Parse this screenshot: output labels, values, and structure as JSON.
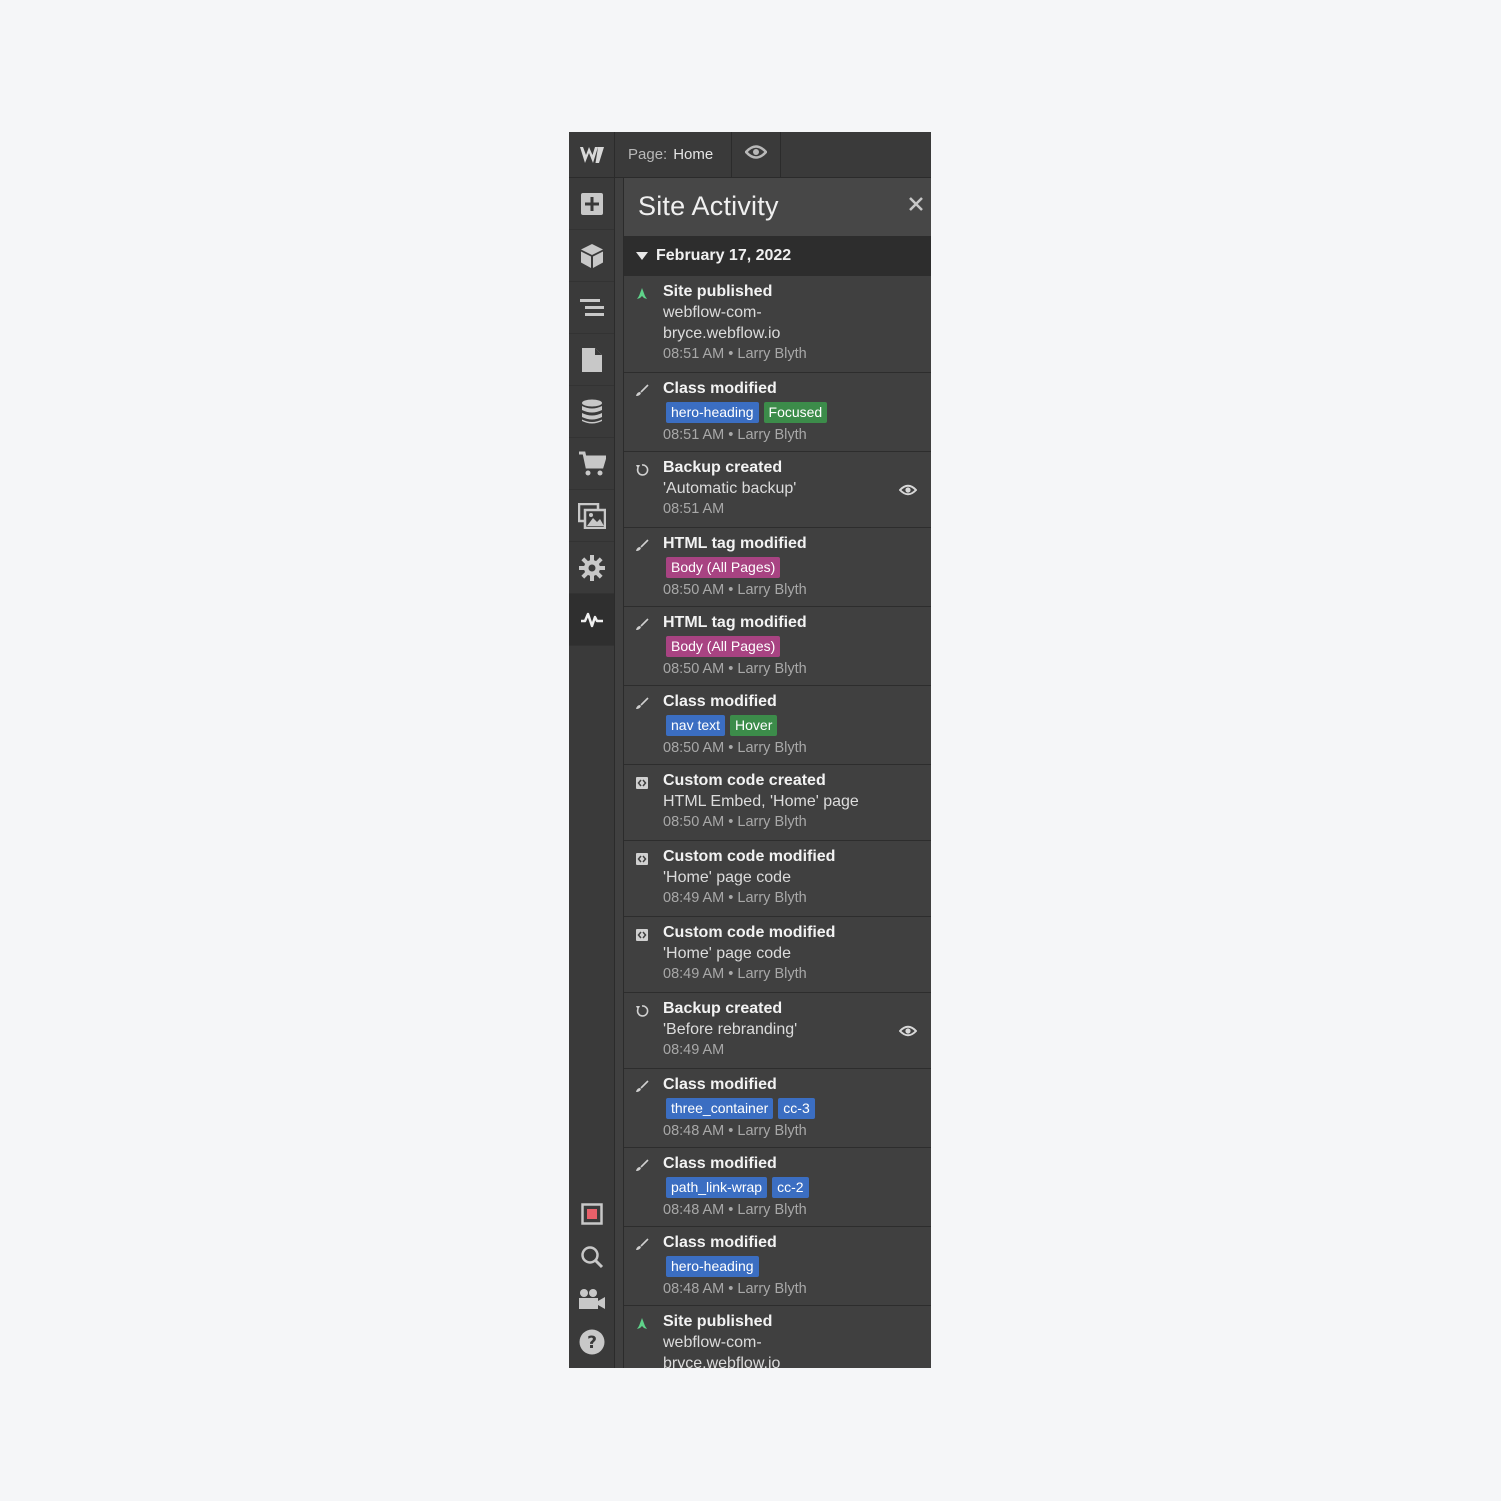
{
  "topbar": {
    "page_prefix": "Page:",
    "page_name": "Home"
  },
  "rail": {
    "items": [
      {
        "icon": "webflow-logo-icon"
      },
      {
        "icon": "add-icon"
      },
      {
        "icon": "components-cube-icon"
      },
      {
        "icon": "navigator-icon"
      },
      {
        "icon": "pages-icon"
      },
      {
        "icon": "cms-database-icon"
      },
      {
        "icon": "ecommerce-cart-icon"
      },
      {
        "icon": "assets-icon"
      },
      {
        "icon": "settings-gear-icon"
      },
      {
        "icon": "site-activity-icon"
      }
    ],
    "bottom_items": [
      {
        "icon": "audit-icon"
      },
      {
        "icon": "search-icon"
      },
      {
        "icon": "video-tutorials-icon"
      },
      {
        "icon": "help-icon"
      }
    ]
  },
  "panel": {
    "title": "Site Activity",
    "date_group": "February 17, 2022"
  },
  "colors": {
    "published_green": "#5fd38a",
    "tag_blue": "#3b6ec2",
    "tag_green": "#3c8c4a",
    "tag_pink": "#a84382"
  },
  "events": [
    {
      "icon": "rocket-icon",
      "title": "Site published",
      "detail_lines": [
        "webflow-com-",
        "bryce.webflow.io"
      ],
      "tags": [],
      "meta": "08:51 AM • Larry Blyth",
      "preview": false
    },
    {
      "icon": "brush-icon",
      "title": "Class modified",
      "detail_lines": [],
      "tags": [
        {
          "label": "hero-heading",
          "color": "blue"
        },
        {
          "label": "Focused",
          "color": "green"
        }
      ],
      "meta": "08:51 AM • Larry Blyth",
      "preview": false
    },
    {
      "icon": "backup-icon",
      "title": "Backup created",
      "detail_lines": [
        "'Automatic backup'"
      ],
      "tags": [],
      "meta": "08:51 AM",
      "preview": true
    },
    {
      "icon": "brush-icon",
      "title": "HTML tag modified",
      "detail_lines": [],
      "tags": [
        {
          "label": "Body (All Pages)",
          "color": "pink"
        }
      ],
      "meta": "08:50 AM • Larry Blyth",
      "preview": false
    },
    {
      "icon": "brush-icon",
      "title": "HTML tag modified",
      "detail_lines": [],
      "tags": [
        {
          "label": "Body (All Pages)",
          "color": "pink"
        }
      ],
      "meta": "08:50 AM • Larry Blyth",
      "preview": false
    },
    {
      "icon": "brush-icon",
      "title": "Class modified",
      "detail_lines": [],
      "tags": [
        {
          "label": "nav text",
          "color": "blue"
        },
        {
          "label": "Hover",
          "color": "green"
        }
      ],
      "meta": "08:50 AM • Larry Blyth",
      "preview": false
    },
    {
      "icon": "code-icon",
      "title": "Custom code created",
      "detail_lines": [
        "HTML Embed, 'Home' page"
      ],
      "tags": [],
      "meta": "08:50 AM • Larry Blyth",
      "preview": false
    },
    {
      "icon": "code-icon",
      "title": "Custom code modified",
      "detail_lines": [
        "'Home' page code"
      ],
      "tags": [],
      "meta": "08:49 AM • Larry Blyth",
      "preview": false
    },
    {
      "icon": "code-icon",
      "title": "Custom code modified",
      "detail_lines": [
        "'Home' page code"
      ],
      "tags": [],
      "meta": "08:49 AM • Larry Blyth",
      "preview": false
    },
    {
      "icon": "backup-icon",
      "title": "Backup created",
      "detail_lines": [
        "'Before rebranding'"
      ],
      "tags": [],
      "meta": "08:49 AM",
      "preview": true
    },
    {
      "icon": "brush-icon",
      "title": "Class modified",
      "detail_lines": [],
      "tags": [
        {
          "label": "three_container",
          "color": "blue"
        },
        {
          "label": "cc-3",
          "color": "blue"
        }
      ],
      "meta": "08:48 AM • Larry Blyth",
      "preview": false
    },
    {
      "icon": "brush-icon",
      "title": "Class modified",
      "detail_lines": [],
      "tags": [
        {
          "label": "path_link-wrap",
          "color": "blue"
        },
        {
          "label": "cc-2",
          "color": "blue"
        }
      ],
      "meta": "08:48 AM • Larry Blyth",
      "preview": false
    },
    {
      "icon": "brush-icon",
      "title": "Class modified",
      "detail_lines": [],
      "tags": [
        {
          "label": "hero-heading",
          "color": "blue"
        }
      ],
      "meta": "08:48 AM • Larry Blyth",
      "preview": false
    },
    {
      "icon": "rocket-icon",
      "title": "Site published",
      "detail_lines": [
        "webflow-com-",
        "bryce.webflow.io"
      ],
      "tags": [],
      "meta": "",
      "preview": false
    }
  ]
}
